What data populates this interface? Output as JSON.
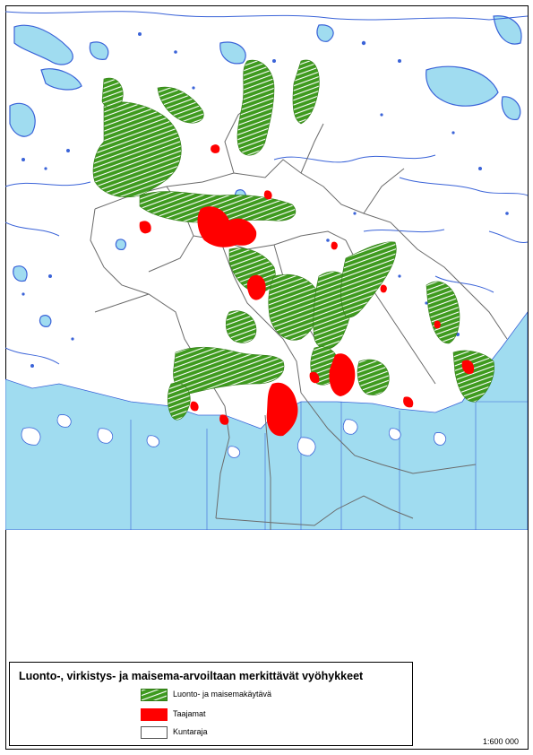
{
  "legend": {
    "title": "Luonto-, virkistys- ja maisema-arvoiltaan merkittävät vyöhykkeet",
    "items": [
      {
        "label": "Luonto- ja maisemakäytävä",
        "fill": "#3e9a1e",
        "hatch": "#ffffff",
        "border": "#2f7a14"
      },
      {
        "label": "Taajamat",
        "fill": "#ff0000",
        "border": "#ff0000"
      },
      {
        "label": "Kuntaraja",
        "fill": "#ffffff",
        "border": "#555555"
      }
    ]
  },
  "scale": "1:600 000",
  "colors": {
    "sea": "#a0dcf0",
    "lake_outline": "#3a63d8",
    "lake_fill": "#a0dcf0",
    "land": "#ffffff",
    "border": "#6b6b6b"
  }
}
